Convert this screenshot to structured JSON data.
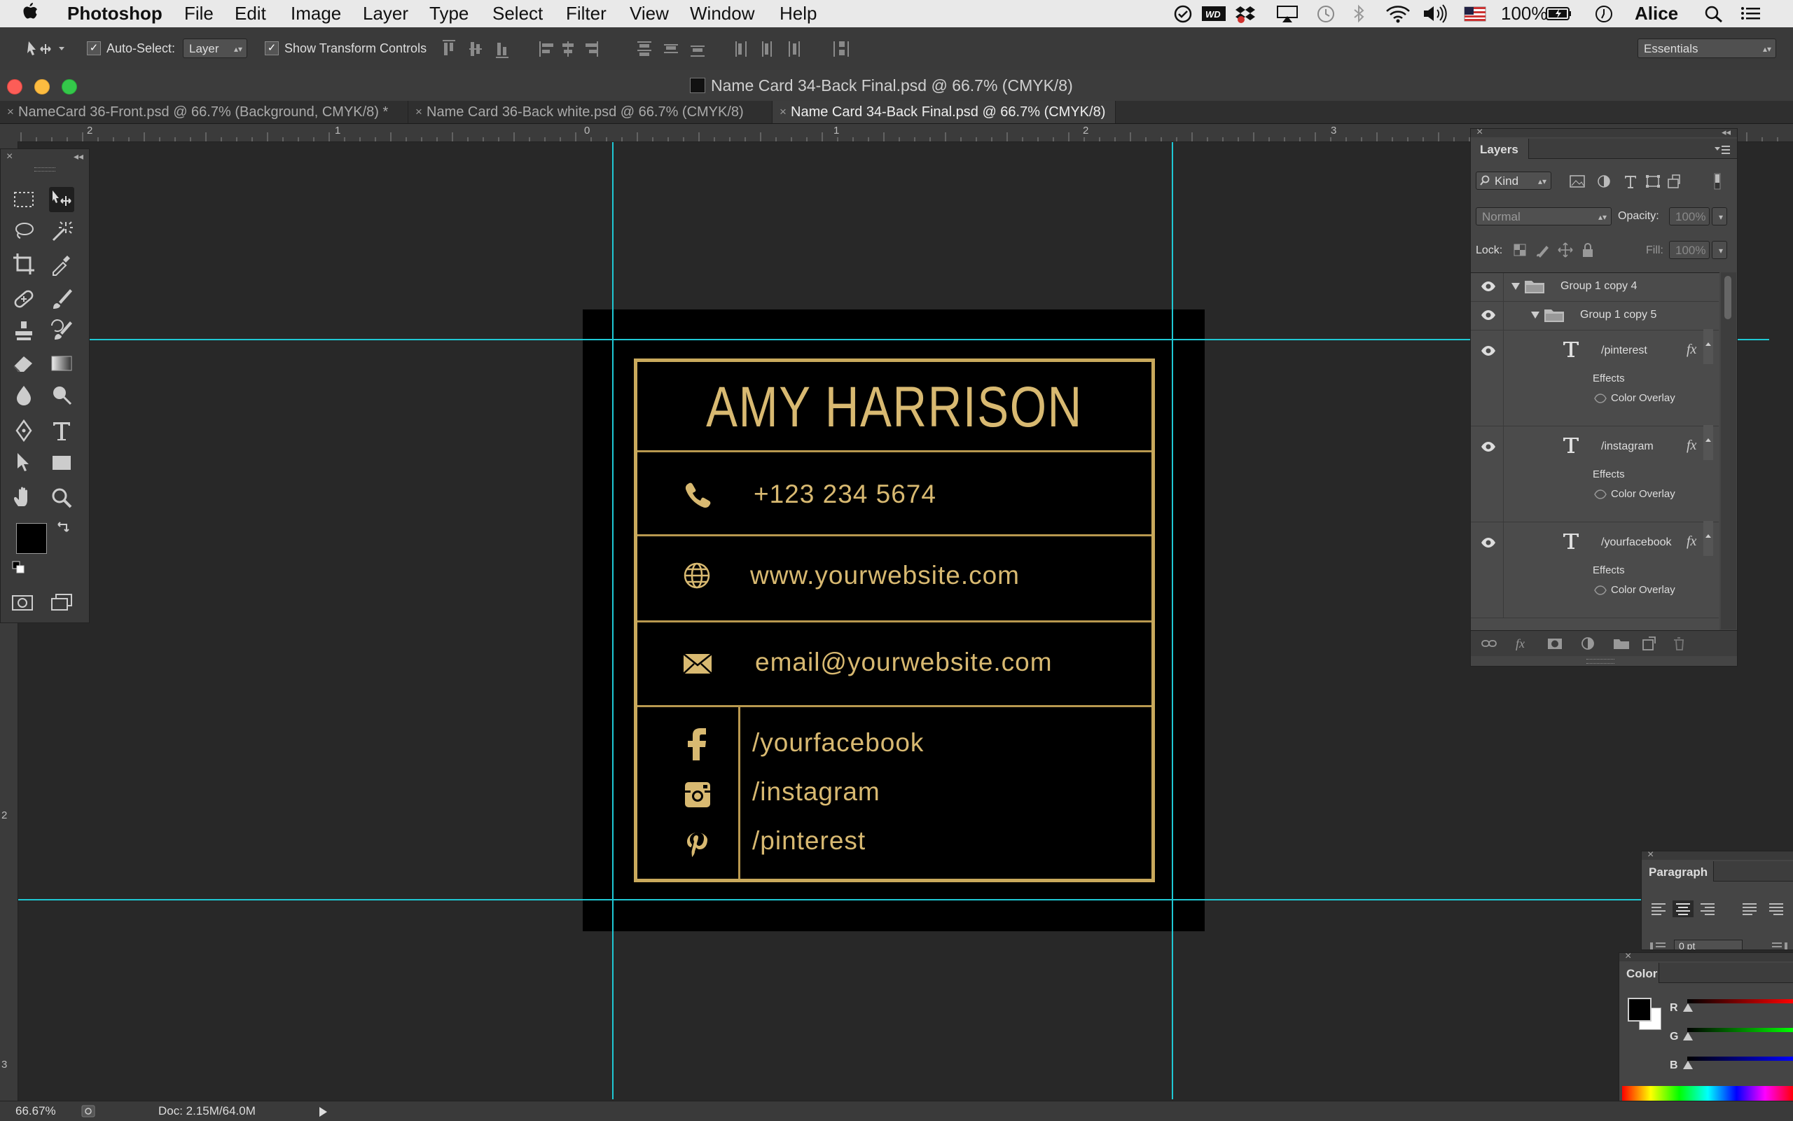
{
  "menubar": {
    "app": "Photoshop",
    "items": [
      "File",
      "Edit",
      "Image",
      "Layer",
      "Type",
      "Select",
      "Filter",
      "View",
      "Window",
      "Help"
    ],
    "battery": "100%",
    "user": "Alice"
  },
  "options_bar": {
    "auto_select_label": "Auto-Select:",
    "auto_select_value": "Layer",
    "show_transform_label": "Show Transform Controls",
    "workspace": "Essentials"
  },
  "window": {
    "title": "Name Card 34-Back Final.psd @ 66.7% (CMYK/8)"
  },
  "tabs": [
    {
      "label": "NameCard 36-Front.psd @ 66.7% (Background, CMYK/8) *",
      "active": false
    },
    {
      "label": "Name Card 36-Back white.psd @ 66.7% (CMYK/8)",
      "active": false
    },
    {
      "label": "Name Card 34-Back Final.psd @ 66.7% (CMYK/8)",
      "active": true
    }
  ],
  "rulers": {
    "top": [
      "2",
      "1",
      "0",
      "1",
      "2",
      "3"
    ],
    "left": [
      "2",
      "3"
    ]
  },
  "card": {
    "name": "AMY HARRISON",
    "phone": "+123 234 5674",
    "website": "www.yourwebsite.com",
    "email": "email@yourwebsite.com",
    "facebook": "/yourfacebook",
    "instagram": "/instagram",
    "pinterest": "/pinterest",
    "gold_color": "#d8b971"
  },
  "layers_panel": {
    "title": "Layers",
    "filter": "Kind",
    "blend_mode": "Normal",
    "opacity_label": "Opacity:",
    "opacity_value": "100%",
    "lock_label": "Lock:",
    "fill_label": "Fill:",
    "fill_value": "100%",
    "groups": [
      "Group 1 copy 4",
      "Group 1 copy 5"
    ],
    "layers": [
      {
        "name": "/pinterest",
        "effects": "Effects",
        "effect": "Color Overlay"
      },
      {
        "name": "/instagram",
        "effects": "Effects",
        "effect": "Color Overlay"
      },
      {
        "name": "/yourfacebook",
        "effects": "Effects",
        "effect": "Color Overlay"
      }
    ]
  },
  "paragraph_panel": {
    "title": "Paragraph",
    "indent_value": "0 pt"
  },
  "color_panel": {
    "title": "Color",
    "channels": [
      "R",
      "G",
      "B"
    ]
  },
  "status_bar": {
    "zoom": "66.67%",
    "doc": "Doc: 2.15M/64.0M"
  },
  "accent": {
    "guide": "#1fc8d4"
  }
}
